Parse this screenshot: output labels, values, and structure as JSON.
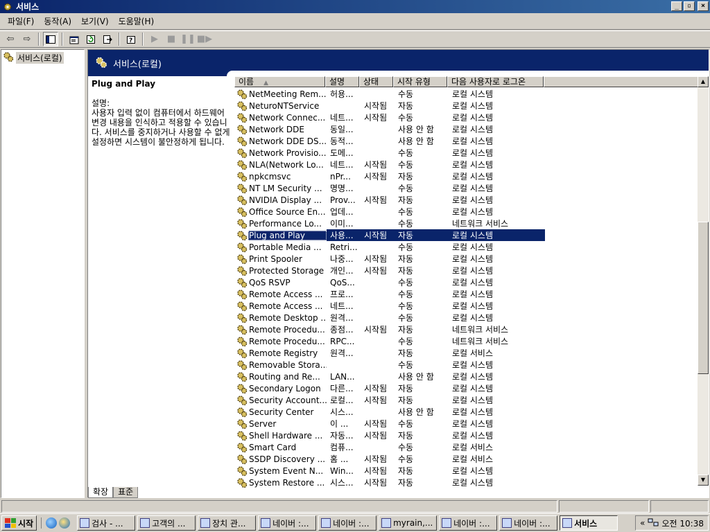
{
  "window": {
    "title": "서비스",
    "controls": {
      "minimize": "_",
      "maximize": "▫",
      "close": "×"
    }
  },
  "menu": [
    "파일(F)",
    "동작(A)",
    "보기(V)",
    "도움말(H)"
  ],
  "tree": {
    "root": "서비스(로컬)"
  },
  "panel": {
    "header": "서비스(로컬)"
  },
  "description": {
    "service_name": "Plug and Play",
    "label": "설명:",
    "text": "사용자 입력 없이 컴퓨터에서 하드웨어 변경 내용을 인식하고 적용할 수 있습니다. 서비스를 중지하거나 사용할 수 없게 설정하면 시스템이 불안정하게 됩니다."
  },
  "columns": {
    "name": "이름",
    "desc": "설명",
    "status": "상태",
    "startup": "시작 유형",
    "logon": "다음 사용자로 로그온"
  },
  "services": [
    {
      "name": "NetMeeting Rem...",
      "desc": "허용...",
      "status": "",
      "startup": "수동",
      "logon": "로컬 시스템"
    },
    {
      "name": "NeturoNTService",
      "desc": "",
      "status": "시작됨",
      "startup": "자동",
      "logon": "로컬 시스템"
    },
    {
      "name": "Network Connec...",
      "desc": "네트...",
      "status": "시작됨",
      "startup": "수동",
      "logon": "로컬 시스템"
    },
    {
      "name": "Network DDE",
      "desc": "동일...",
      "status": "",
      "startup": "사용 안 함",
      "logon": "로컬 시스템"
    },
    {
      "name": "Network DDE DS...",
      "desc": "동적...",
      "status": "",
      "startup": "사용 안 함",
      "logon": "로컬 시스템"
    },
    {
      "name": "Network Provisio...",
      "desc": "도메...",
      "status": "",
      "startup": "수동",
      "logon": "로컬 시스템"
    },
    {
      "name": "NLA(Network Lo...",
      "desc": "네트...",
      "status": "시작됨",
      "startup": "수동",
      "logon": "로컬 시스템"
    },
    {
      "name": "npkcmsvc",
      "desc": "nPr...",
      "status": "시작됨",
      "startup": "자동",
      "logon": "로컬 시스템"
    },
    {
      "name": "NT LM Security ...",
      "desc": "명명...",
      "status": "",
      "startup": "수동",
      "logon": "로컬 시스템"
    },
    {
      "name": "NVIDIA Display ...",
      "desc": "Prov...",
      "status": "시작됨",
      "startup": "자동",
      "logon": "로컬 시스템"
    },
    {
      "name": "Office Source En...",
      "desc": "업데...",
      "status": "",
      "startup": "수동",
      "logon": "로컬 시스템"
    },
    {
      "name": "Performance Lo...",
      "desc": "이미...",
      "status": "",
      "startup": "수동",
      "logon": "네트워크 서비스"
    },
    {
      "name": "Plug and Play",
      "desc": "사용...",
      "status": "시작됨",
      "startup": "자동",
      "logon": "로컬 시스템",
      "selected": true
    },
    {
      "name": "Portable Media ...",
      "desc": "Retri...",
      "status": "",
      "startup": "수동",
      "logon": "로컬 시스템"
    },
    {
      "name": "Print Spooler",
      "desc": "나중...",
      "status": "시작됨",
      "startup": "자동",
      "logon": "로컬 시스템"
    },
    {
      "name": "Protected Storage",
      "desc": "개인...",
      "status": "시작됨",
      "startup": "자동",
      "logon": "로컬 시스템"
    },
    {
      "name": "QoS RSVP",
      "desc": "QoS...",
      "status": "",
      "startup": "수동",
      "logon": "로컬 시스템"
    },
    {
      "name": "Remote Access ...",
      "desc": "프로...",
      "status": "",
      "startup": "수동",
      "logon": "로컬 시스템"
    },
    {
      "name": "Remote Access ...",
      "desc": "네트...",
      "status": "",
      "startup": "수동",
      "logon": "로컬 시스템"
    },
    {
      "name": "Remote Desktop ...",
      "desc": "원격...",
      "status": "",
      "startup": "수동",
      "logon": "로컬 시스템"
    },
    {
      "name": "Remote Procedu...",
      "desc": "종점...",
      "status": "시작됨",
      "startup": "자동",
      "logon": "네트워크 서비스"
    },
    {
      "name": "Remote Procedu...",
      "desc": "RPC...",
      "status": "",
      "startup": "수동",
      "logon": "네트워크 서비스"
    },
    {
      "name": "Remote Registry",
      "desc": "원격...",
      "status": "",
      "startup": "자동",
      "logon": "로컬 서비스"
    },
    {
      "name": "Removable Stora...",
      "desc": "",
      "status": "",
      "startup": "수동",
      "logon": "로컬 시스템"
    },
    {
      "name": "Routing and Re...",
      "desc": "LAN...",
      "status": "",
      "startup": "사용 안 함",
      "logon": "로컬 시스템"
    },
    {
      "name": "Secondary Logon",
      "desc": "다른...",
      "status": "시작됨",
      "startup": "자동",
      "logon": "로컬 시스템"
    },
    {
      "name": "Security Account...",
      "desc": "로컬...",
      "status": "시작됨",
      "startup": "자동",
      "logon": "로컬 시스템"
    },
    {
      "name": "Security Center",
      "desc": "시스...",
      "status": "",
      "startup": "사용 안 함",
      "logon": "로컬 시스템"
    },
    {
      "name": "Server",
      "desc": "이 ...",
      "status": "시작됨",
      "startup": "수동",
      "logon": "로컬 시스템"
    },
    {
      "name": "Shell Hardware ...",
      "desc": "자동...",
      "status": "시작됨",
      "startup": "자동",
      "logon": "로컬 시스템"
    },
    {
      "name": "Smart Card",
      "desc": "컴퓨...",
      "status": "",
      "startup": "수동",
      "logon": "로컬 서비스"
    },
    {
      "name": "SSDP Discovery ...",
      "desc": "홈 ...",
      "status": "시작됨",
      "startup": "수동",
      "logon": "로컬 서비스"
    },
    {
      "name": "System Event N...",
      "desc": "Win...",
      "status": "시작됨",
      "startup": "자동",
      "logon": "로컬 시스템"
    },
    {
      "name": "System Restore ...",
      "desc": "시스...",
      "status": "시작됨",
      "startup": "자동",
      "logon": "로컬 시스템"
    }
  ],
  "tabs": [
    "확장",
    "표준"
  ],
  "taskbar": {
    "start": "시작",
    "tasks": [
      "검사 - ...",
      "고객의 ...",
      "장치 관...",
      "네이버 :...",
      "네이버 :...",
      "myrain,...",
      "네이버 :...",
      "네이버 :...",
      "서비스"
    ],
    "tray_arrows": "«",
    "clock": "오전 10:38"
  }
}
